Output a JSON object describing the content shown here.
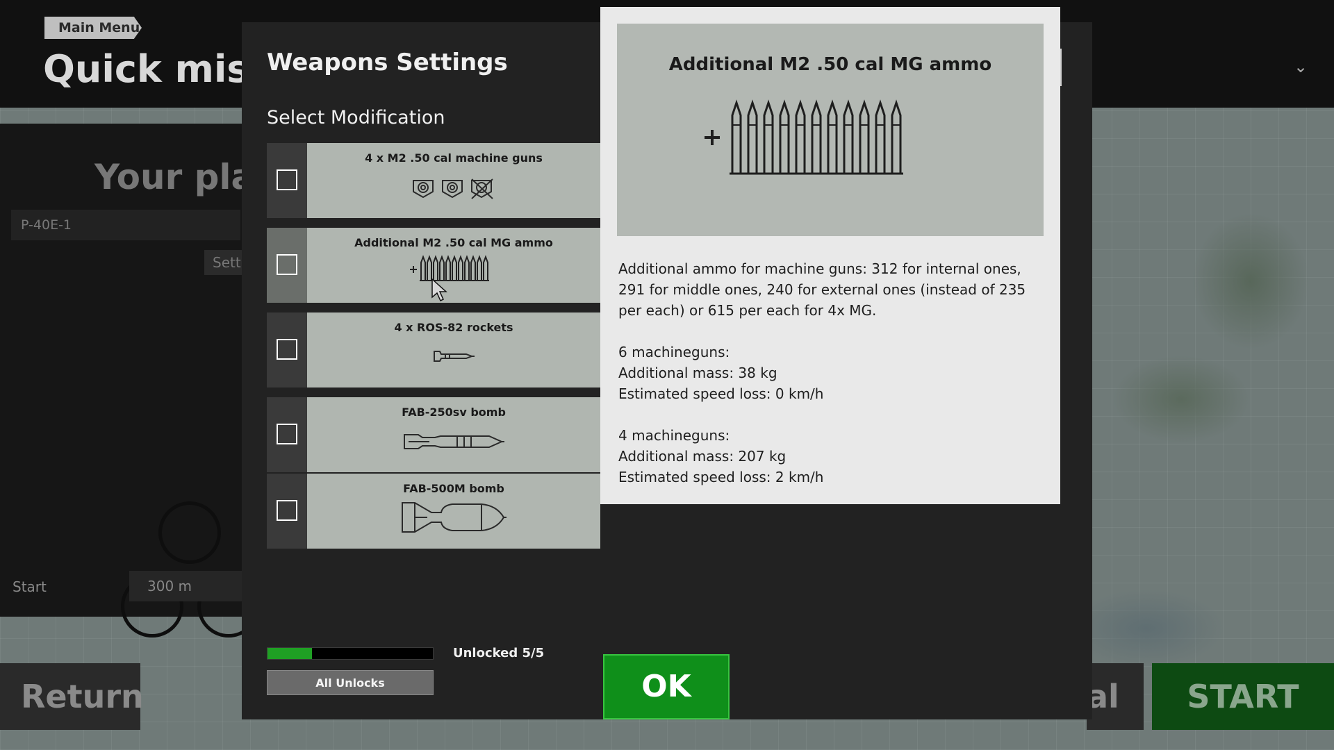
{
  "background": {
    "breadcrumb": "Main Menu",
    "title": "Quick missi",
    "your_plane": "Your plane",
    "plane_value": "P-40E-1",
    "settings_label": "Sett",
    "start_label": "Start",
    "start_value": "300 m",
    "return_label": "Return",
    "final_label": "al",
    "start_button": "START"
  },
  "modal": {
    "title": "Weapons Settings",
    "subtitle": "Select Modification",
    "close_icon": "close-icon",
    "modifications": [
      {
        "label": "4 x M2 .50 cal machine guns",
        "icon": "machine-guns-icon",
        "checked": false
      },
      {
        "label": "Additional M2 .50 cal MG ammo",
        "icon": "ammo-icon",
        "checked": false,
        "hovered": true
      },
      {
        "label": "4 x ROS-82 rockets",
        "icon": "rocket-icon",
        "checked": false
      },
      {
        "label": "FAB-250sv bomb",
        "icon": "bomb-icon",
        "checked": false
      },
      {
        "label": "FAB-500M bomb",
        "icon": "bomb-icon",
        "checked": false
      }
    ],
    "unlock_progress": 0.27,
    "unlock_text": "Unlocked 5/5",
    "all_unlocks": "All Unlocks",
    "ok": "OK"
  },
  "tooltip": {
    "title": "Additional M2 .50 cal MG ammo",
    "description": "Additional ammo for machine guns: 312 for internal ones, 291 for middle ones, 240 for external ones (instead of 235 per each) or 615 per each for 4x MG.",
    "six_mg_header": "6 machineguns:",
    "six_mg_mass": "Additional mass: 38 kg",
    "six_mg_speed": "Estimated speed loss: 0 km/h",
    "four_mg_header": "4 machineguns:",
    "four_mg_mass": "Additional mass: 207 kg",
    "four_mg_speed": "Estimated speed loss: 2 km/h"
  },
  "colors": {
    "ok_green": "#0f8f1a",
    "progress_green": "#1fa024",
    "card_bg": "#b0b6b0"
  }
}
